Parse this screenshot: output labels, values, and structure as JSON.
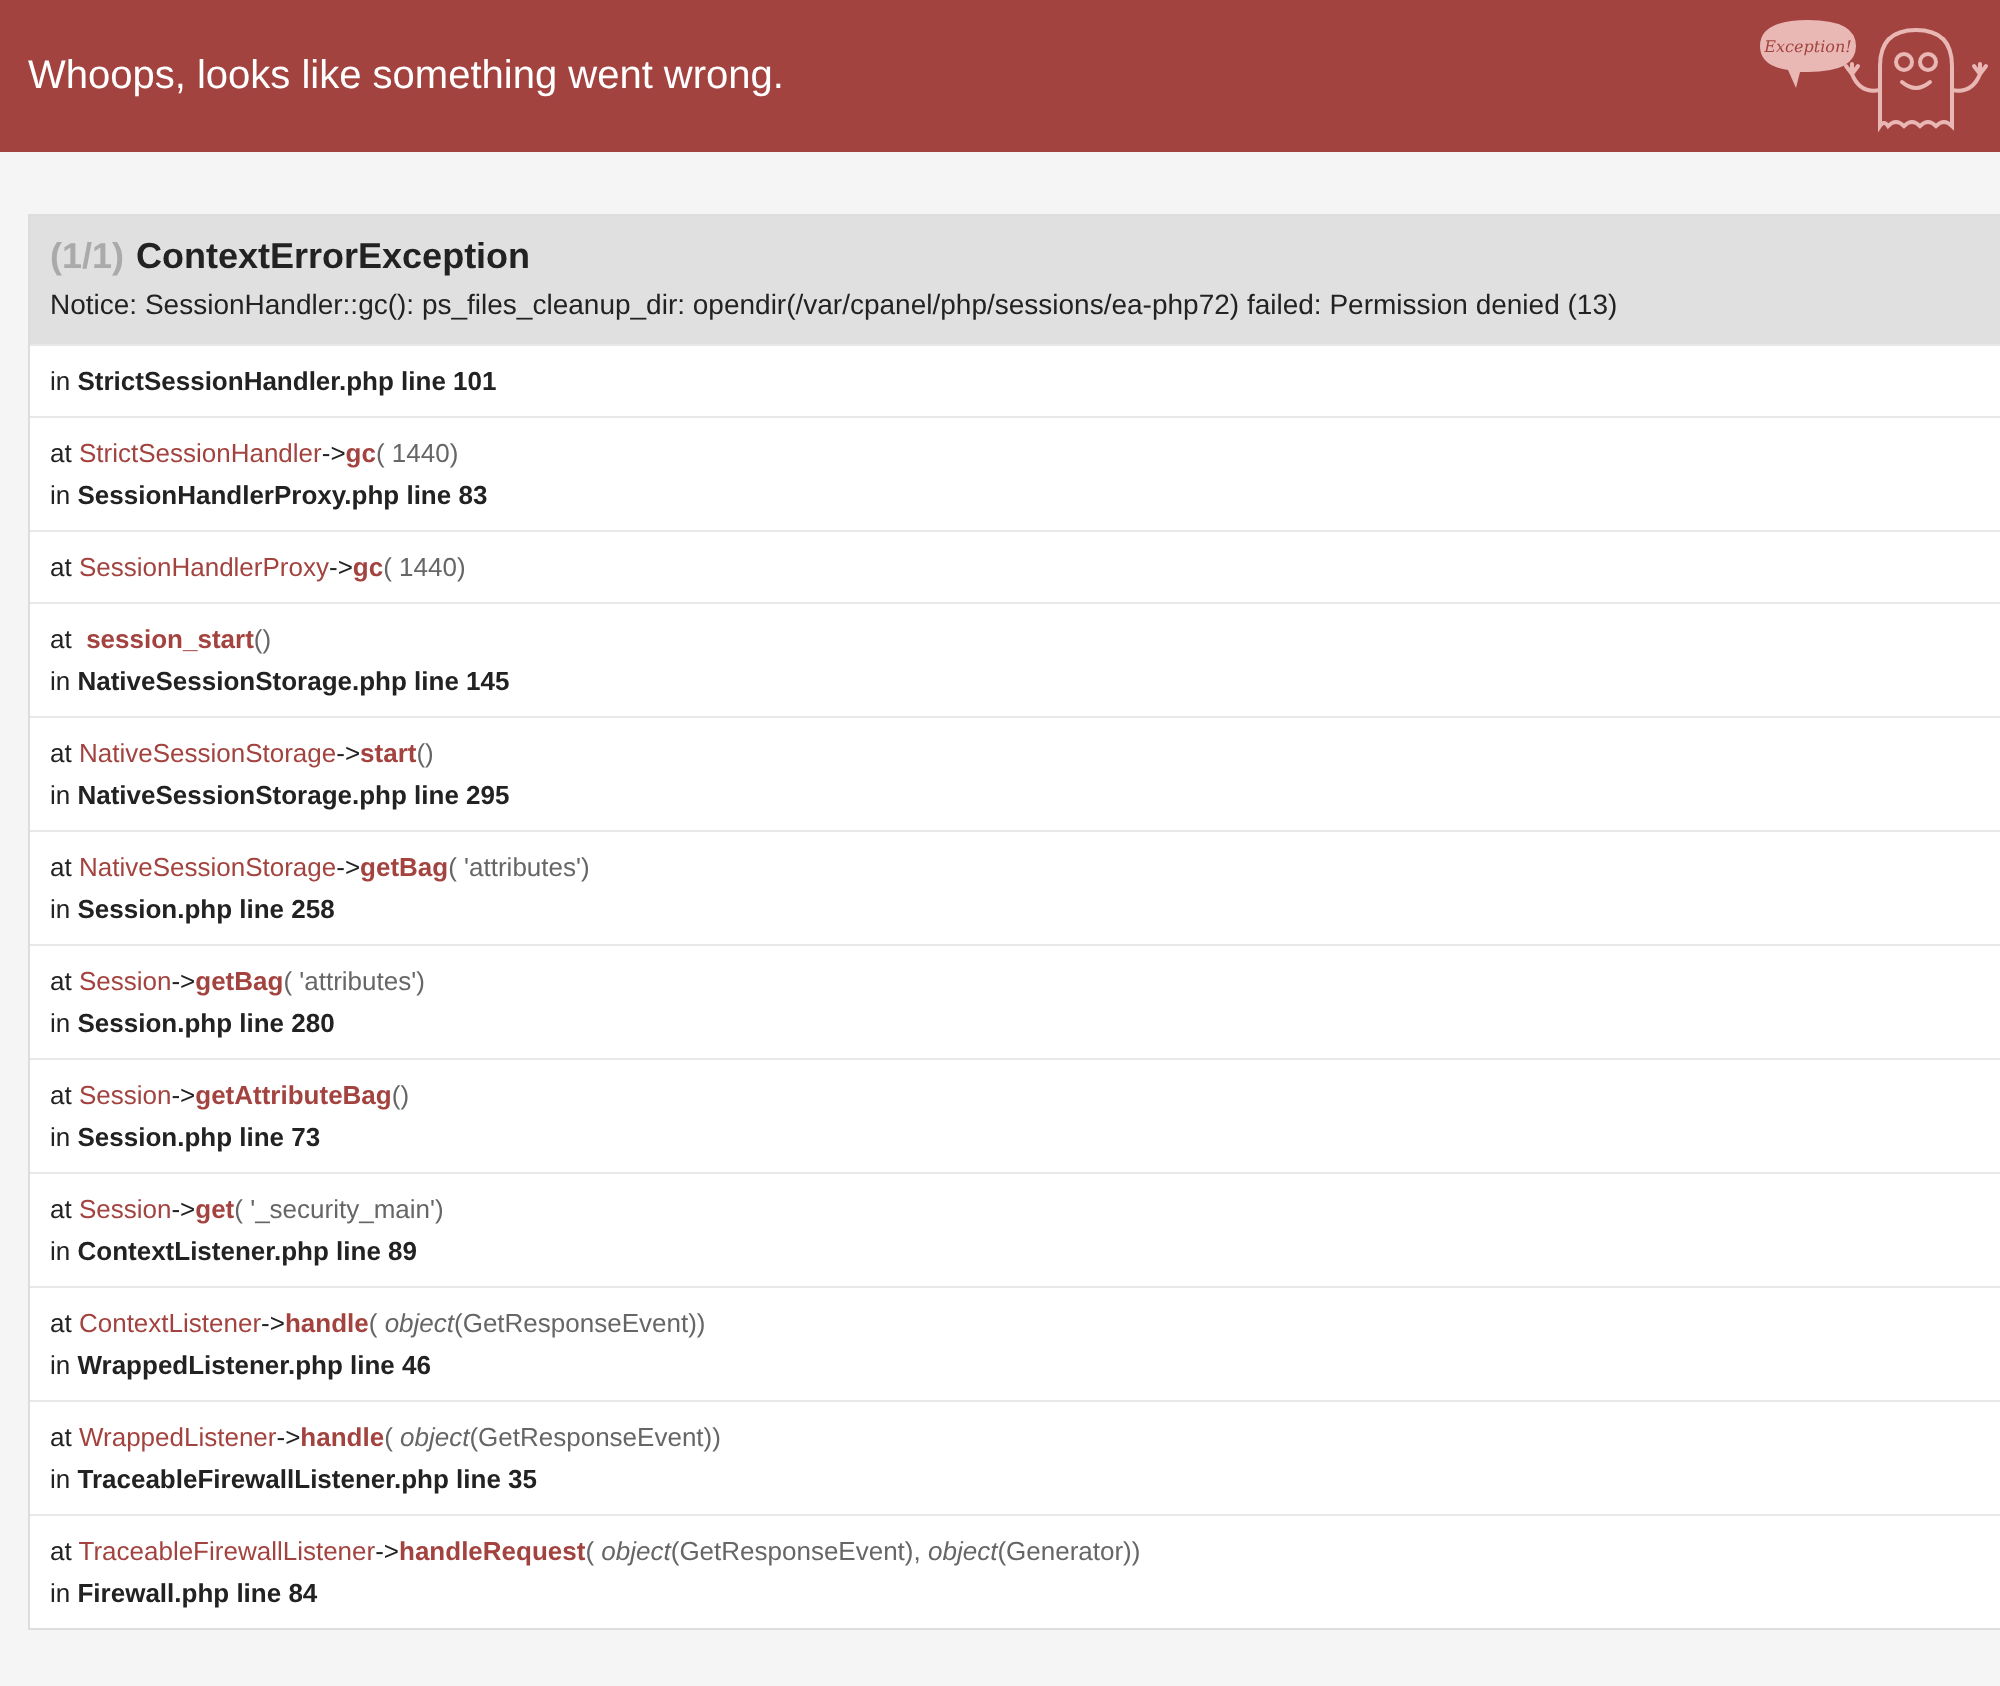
{
  "header": {
    "title": "Whoops, looks like something went wrong.",
    "logo_text": "Exception!"
  },
  "exception": {
    "counter": "(1/1)",
    "name": "ContextErrorException",
    "message": "Notice: SessionHandler::gc(): ps_files_cleanup_dir: opendir(/var/cpanel/php/sessions/ea-php72) failed: Permission denied (13)"
  },
  "trace": [
    {
      "location": "in **StrictSessionHandler.php line 101**"
    },
    {
      "kind": "method",
      "prefix": "at",
      "class": "StrictSessionHandler",
      "arrow": "->",
      "function": "gc",
      "args": "( 1440)",
      "location": "in **SessionHandlerProxy.php line 83**"
    },
    {
      "kind": "method",
      "prefix": "at",
      "class": "SessionHandlerProxy",
      "arrow": "->",
      "function": "gc",
      "args": "( 1440)"
    },
    {
      "kind": "function",
      "prefix": "at",
      "function": "session_start",
      "args": "()",
      "location": "in **NativeSessionStorage.php line 145**"
    },
    {
      "kind": "method",
      "prefix": "at",
      "class": "NativeSessionStorage",
      "arrow": "->",
      "function": "start",
      "args": "()",
      "location": "in **NativeSessionStorage.php line 295**"
    },
    {
      "kind": "method",
      "prefix": "at",
      "class": "NativeSessionStorage",
      "arrow": "->",
      "function": "getBag",
      "args": "( 'attributes')",
      "location": "in **Session.php line 258**"
    },
    {
      "kind": "method",
      "prefix": "at",
      "class": "Session",
      "arrow": "->",
      "function": "getBag",
      "args": "( 'attributes')",
      "location": "in **Session.php line 280**"
    },
    {
      "kind": "method",
      "prefix": "at",
      "class": "Session",
      "arrow": "->",
      "function": "getAttributeBag",
      "args": "()",
      "location": "in **Session.php line 73**"
    },
    {
      "kind": "method",
      "prefix": "at",
      "class": "Session",
      "arrow": "->",
      "function": "get",
      "args": "( '_security_main')",
      "location": "in **ContextListener.php line 89**"
    },
    {
      "kind": "method",
      "prefix": "at",
      "class": "ContextListener",
      "arrow": "->",
      "function": "handle",
      "args": "( *object*(GetResponseEvent))",
      "location": "in **WrappedListener.php line 46**"
    },
    {
      "kind": "method",
      "prefix": "at",
      "class": "WrappedListener",
      "arrow": "->",
      "function": "handle",
      "args": "( *object*(GetResponseEvent))",
      "location": "in **TraceableFirewallListener.php line 35**"
    },
    {
      "kind": "method",
      "prefix": "at",
      "class": "TraceableFirewallListener",
      "arrow": "->",
      "function": "handleRequest",
      "args": "( *object*(GetResponseEvent), *object*(Generator))",
      "location": "in **Firewall.php line 84**"
    }
  ]
}
